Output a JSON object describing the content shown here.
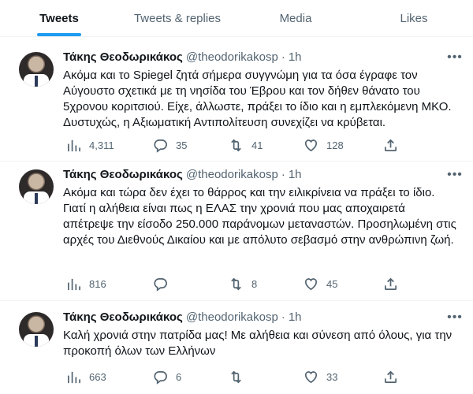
{
  "tabs": [
    "Tweets",
    "Tweets & replies",
    "Media",
    "Likes"
  ],
  "tweets": [
    {
      "name": "Τάκης Θεοδωρικάκος",
      "handle": "@theodorikakosp",
      "dot": "·",
      "time": "1h",
      "text": "Ακόμα και το Spiegel ζητά σήμερα συγγνώμη για τα όσα έγραφε τον Αύγουστο σχετικά με τη νησίδα του Έβρου και τον δήθεν θάνατο του 5χρονου κοριτσιού. Είχε, άλλωστε, πράξει το ίδιο και η εμπλεκόμενη ΜΚΟ. Δυστυχώς, η Αξιωματική Αντιπολίτευση συνεχίζει να κρύβεται.",
      "views": "4,311",
      "replies": "35",
      "retweets": "41",
      "likes": "128"
    },
    {
      "name": "Τάκης Θεοδωρικάκος",
      "handle": "@theodorikakosp",
      "dot": "·",
      "time": "1h",
      "text": "Ακόμα και τώρα δεν έχει το θάρρος και την ειλικρίνεια να πράξει το ίδιο. Γιατί η αλήθεια είναι πως η ΕΛΑΣ την χρονιά που μας αποχαιρετά απέτρεψε την είσοδο 250.000 παράνομων μεταναστών. Προσηλωμένη στις αρχές του Διεθνούς Δικαίου και με απόλυτο σεβασμό στην ανθρώπινη ζωή.",
      "views": "816",
      "replies": "",
      "retweets": "8",
      "likes": "45"
    },
    {
      "name": "Τάκης Θεοδωρικάκος",
      "handle": "@theodorikakosp",
      "dot": "·",
      "time": "1h",
      "text": "Καλή χρονιά στην πατρίδα μας! Με αλήθεια και σύνεση από όλους, για την προκοπή όλων των Ελλήνων",
      "views": "663",
      "replies": "6",
      "retweets": "",
      "likes": "33"
    }
  ],
  "icons": {
    "views": "bar-chart-icon",
    "reply": "reply-icon",
    "retweet": "retweet-icon",
    "like": "heart-icon",
    "share": "share-icon",
    "more": "more-icon"
  },
  "colors": {
    "accent": "#1d9bf0",
    "secondary_text": "#536471",
    "divider": "#eff3f4"
  }
}
